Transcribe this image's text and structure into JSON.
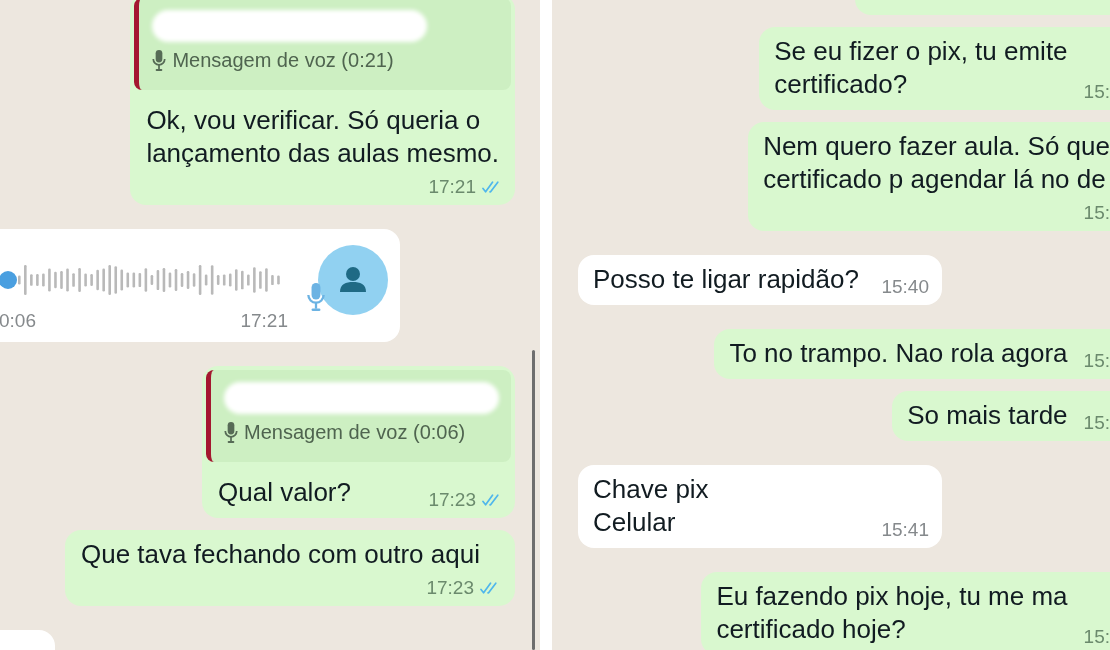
{
  "panels": [
    {
      "messages": [
        {
          "kind": "text",
          "outgoing": true,
          "quote": {
            "sender_redacted": true,
            "label": "Mensagem de voz (0:21)"
          },
          "text": "Ok, vou verificar. Só queria o\nlançamento das aulas mesmo.",
          "time": "17:21",
          "read": true
        },
        {
          "kind": "voice",
          "outgoing": false,
          "level": 0,
          "duration": "0:06",
          "time": "17:21"
        },
        {
          "kind": "text",
          "outgoing": true,
          "quote": {
            "sender_redacted": true,
            "label": "Mensagem de voz (0:06)"
          },
          "text": "Qual valor?",
          "time": "17:23",
          "read": true
        },
        {
          "kind": "text",
          "outgoing": true,
          "text": "Que tava fechando com outro aqui",
          "time": "17:23",
          "read": true
        },
        {
          "kind": "clipped",
          "outgoing": false
        }
      ]
    },
    {
      "messages": [
        {
          "kind": "clipped",
          "outgoing": true
        },
        {
          "kind": "text",
          "outgoing": true,
          "text": "Se eu fizer o pix, tu emite\ncertificado?",
          "time": "15:"
        },
        {
          "kind": "text",
          "outgoing": true,
          "text": "Nem quero fazer aula. Só que\ncertificado p agendar lá no de",
          "time": "15:"
        },
        {
          "kind": "text",
          "outgoing": false,
          "text": "Posso te ligar rapidão?",
          "time": "15:40"
        },
        {
          "kind": "text",
          "outgoing": true,
          "text": "To no trampo. Nao rola agora",
          "time": "15:"
        },
        {
          "kind": "text",
          "outgoing": true,
          "text": "So mais tarde",
          "time": "15:"
        },
        {
          "kind": "text",
          "outgoing": false,
          "text": "Chave pix\nCelular",
          "time": "15:41"
        },
        {
          "kind": "text",
          "outgoing": true,
          "text": "Eu fazendo pix hoje, tu me ma\ncertificado hoje?",
          "time": "15:"
        }
      ]
    }
  ]
}
